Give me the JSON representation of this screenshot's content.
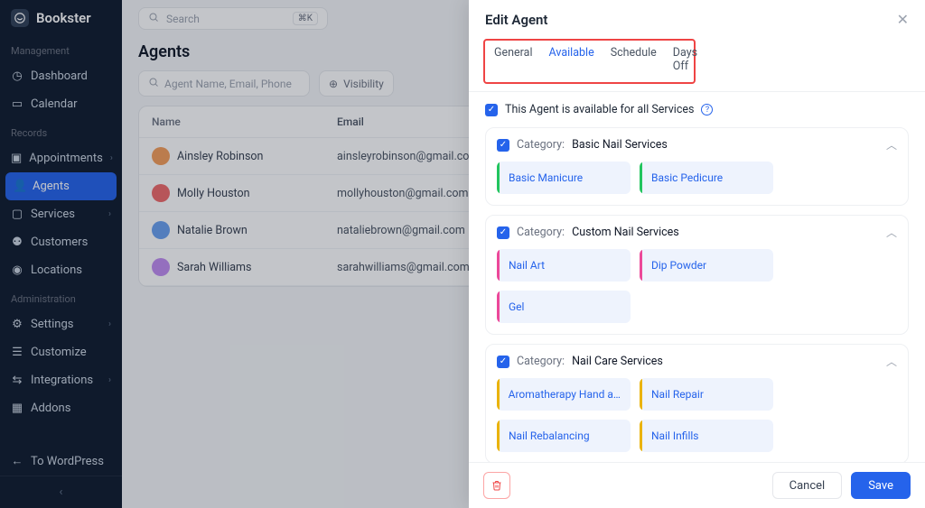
{
  "brand": "Bookster",
  "search": {
    "placeholder": "Search",
    "kbd": "⌘K"
  },
  "sidebar": {
    "sections": [
      {
        "label": "Management",
        "items": [
          {
            "icon": "gauge",
            "label": "Dashboard",
            "chev": false
          },
          {
            "icon": "calendar",
            "label": "Calendar",
            "chev": false
          }
        ]
      },
      {
        "label": "Records",
        "items": [
          {
            "icon": "calendar-check",
            "label": "Appointments",
            "chev": true
          },
          {
            "icon": "user",
            "label": "Agents",
            "chev": false,
            "active": true
          },
          {
            "icon": "briefcase",
            "label": "Services",
            "chev": true
          },
          {
            "icon": "users",
            "label": "Customers",
            "chev": false
          },
          {
            "icon": "pin",
            "label": "Locations",
            "chev": false
          }
        ]
      },
      {
        "label": "Administration",
        "items": [
          {
            "icon": "gear",
            "label": "Settings",
            "chev": true
          },
          {
            "icon": "sliders",
            "label": "Customize",
            "chev": false
          },
          {
            "icon": "share",
            "label": "Integrations",
            "chev": true
          },
          {
            "icon": "grid",
            "label": "Addons",
            "chev": false
          }
        ]
      }
    ],
    "wp_link": "To WordPress"
  },
  "page": {
    "title": "Agents",
    "filter_placeholder": "Agent Name, Email, Phone",
    "visibility_label": "Visibility",
    "columns": {
      "name": "Name",
      "email": "Email"
    },
    "rows": [
      {
        "name": "Ainsley Robinson",
        "email": "ainsleyrobinson@gmail.com",
        "av": "a1"
      },
      {
        "name": "Molly Houston",
        "email": "mollyhouston@gmail.com",
        "av": "a2"
      },
      {
        "name": "Natalie Brown",
        "email": "nataliebrown@gmail.com",
        "av": "a3"
      },
      {
        "name": "Sarah Williams",
        "email": "sarahwilliams@gmail.com",
        "av": "a4"
      }
    ]
  },
  "drawer": {
    "title": "Edit Agent",
    "tabs": [
      "General",
      "Available",
      "Schedule",
      "Days Off"
    ],
    "active_tab": "Available",
    "all_services_label": "This Agent is available for all Services",
    "category_prefix": "Category:",
    "categories": [
      {
        "name": "Basic Nail Services",
        "color": "bar-green",
        "services": [
          "Basic Manicure",
          "Basic Pedicure"
        ]
      },
      {
        "name": "Custom Nail Services",
        "color": "bar-pink",
        "services": [
          "Nail Art",
          "Dip Powder",
          "Gel"
        ]
      },
      {
        "name": "Nail Care Services",
        "color": "bar-yellow",
        "services": [
          "Aromatherapy Hand and ...",
          "Nail Repair",
          "Nail Rebalancing",
          "Nail Infills"
        ]
      }
    ],
    "buttons": {
      "cancel": "Cancel",
      "save": "Save"
    }
  }
}
